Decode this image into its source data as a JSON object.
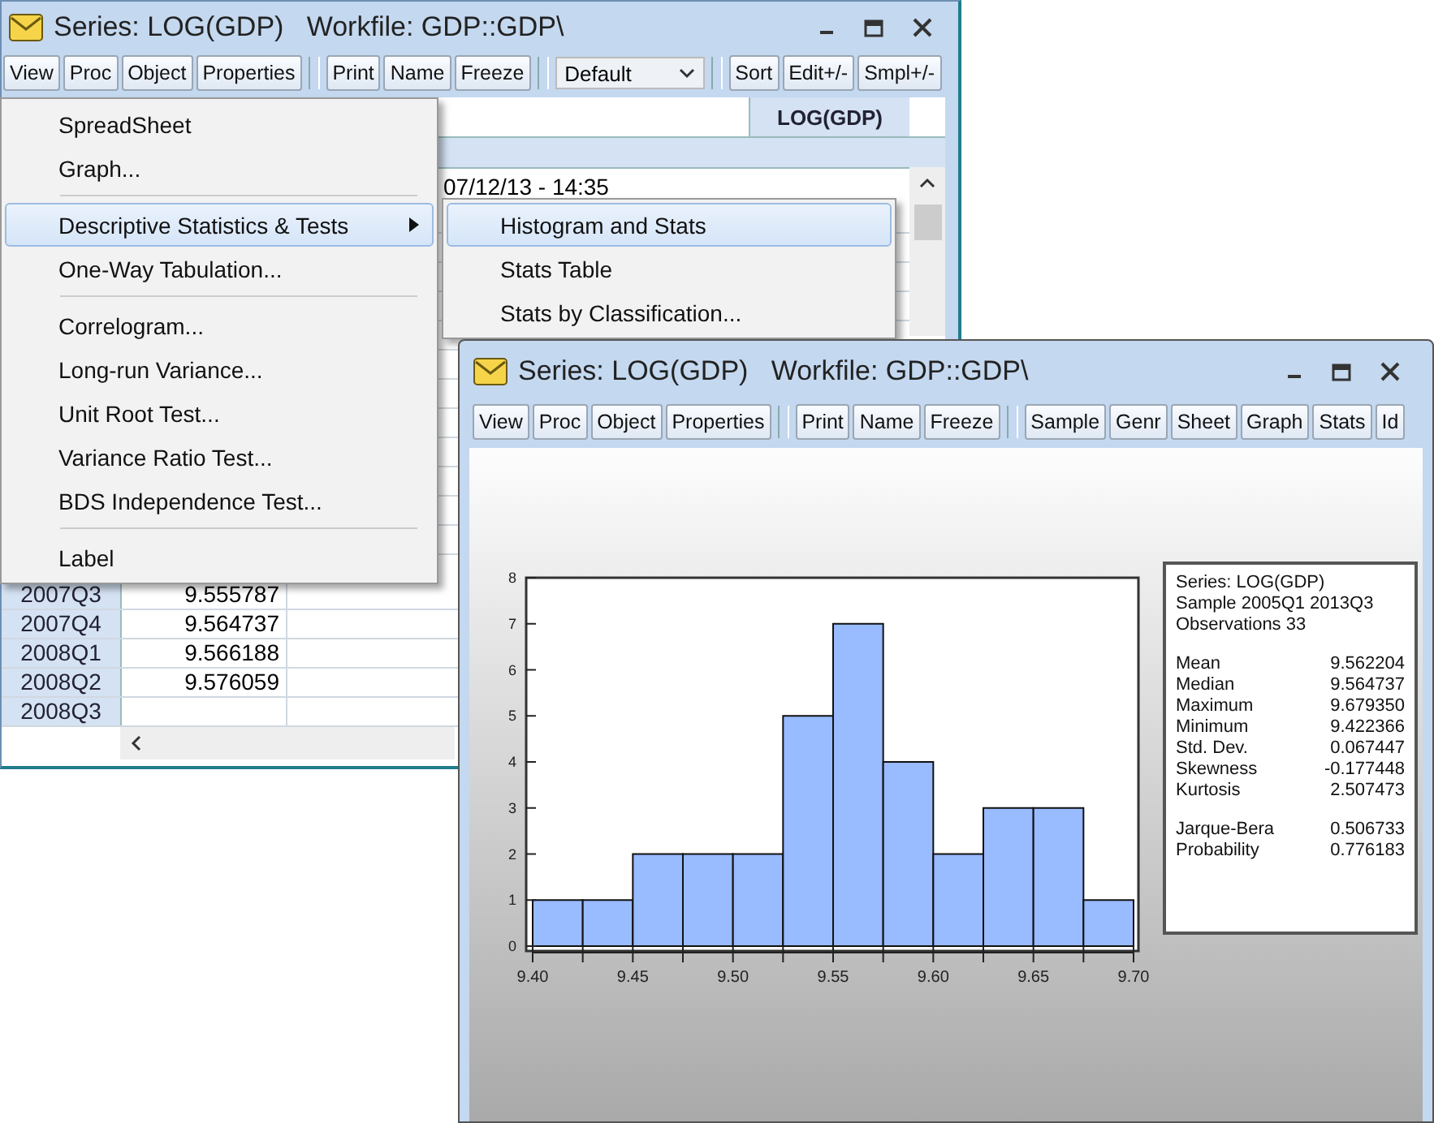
{
  "back_window": {
    "title": "Series: LOG(GDP)   Workfile: GDP::GDP\\",
    "toolbar": [
      {
        "kind": "button",
        "label": "View"
      },
      {
        "kind": "button",
        "label": "Proc"
      },
      {
        "kind": "button",
        "label": "Object"
      },
      {
        "kind": "button",
        "label": "Properties"
      },
      {
        "kind": "separator"
      },
      {
        "kind": "button",
        "label": "Print"
      },
      {
        "kind": "button",
        "label": "Name"
      },
      {
        "kind": "button",
        "label": "Freeze"
      },
      {
        "kind": "separator"
      },
      {
        "kind": "dropdown",
        "label": "Default"
      },
      {
        "kind": "separator"
      },
      {
        "kind": "button",
        "label": "Sort"
      },
      {
        "kind": "button",
        "label": "Edit+/-"
      },
      {
        "kind": "button",
        "label": "Smpl+/-"
      }
    ],
    "spreadsheet": {
      "column_header": "LOG(GDP)",
      "updated": "07/12/13 - 14:35",
      "rows": [
        {
          "obs": "2007Q3",
          "value": "9.555787"
        },
        {
          "obs": "2007Q4",
          "value": "9.564737"
        },
        {
          "obs": "2008Q1",
          "value": "9.566188"
        },
        {
          "obs": "2008Q2",
          "value": "9.576059"
        },
        {
          "obs": "2008Q3"
        }
      ]
    }
  },
  "menu": {
    "items": [
      {
        "kind": "item",
        "label": "SpreadSheet",
        "selected": false,
        "submenu": false
      },
      {
        "kind": "item",
        "label": "Graph...",
        "selected": false,
        "submenu": false
      },
      {
        "kind": "separator"
      },
      {
        "kind": "item",
        "label": "Descriptive Statistics & Tests",
        "selected": true,
        "submenu": true
      },
      {
        "kind": "item",
        "label": "One-Way Tabulation...",
        "selected": false,
        "submenu": false
      },
      {
        "kind": "separator"
      },
      {
        "kind": "item",
        "label": "Correlogram...",
        "selected": false,
        "submenu": false
      },
      {
        "kind": "item",
        "label": "Long-run Variance...",
        "selected": false,
        "submenu": false
      },
      {
        "kind": "item",
        "label": "Unit Root Test...",
        "selected": false,
        "submenu": false
      },
      {
        "kind": "item",
        "label": "Variance Ratio Test...",
        "selected": false,
        "submenu": false
      },
      {
        "kind": "item",
        "label": "BDS Independence Test...",
        "selected": false,
        "submenu": false
      },
      {
        "kind": "separator"
      },
      {
        "kind": "item",
        "label": "Label",
        "selected": false,
        "submenu": false
      }
    ]
  },
  "submenu": {
    "items": [
      {
        "label": "Histogram and Stats",
        "selected": true
      },
      {
        "label": "Stats Table",
        "selected": false
      },
      {
        "label": "Stats by Classification...",
        "selected": false
      }
    ]
  },
  "front_window": {
    "title": "Series: LOG(GDP)   Workfile: GDP::GDP\\",
    "toolbar": [
      {
        "kind": "button",
        "label": "View"
      },
      {
        "kind": "button",
        "label": "Proc"
      },
      {
        "kind": "button",
        "label": "Object"
      },
      {
        "kind": "button",
        "label": "Properties"
      },
      {
        "kind": "separator"
      },
      {
        "kind": "button",
        "label": "Print"
      },
      {
        "kind": "button",
        "label": "Name"
      },
      {
        "kind": "button",
        "label": "Freeze"
      },
      {
        "kind": "separator"
      },
      {
        "kind": "button",
        "label": "Sample"
      },
      {
        "kind": "button",
        "label": "Genr"
      },
      {
        "kind": "button",
        "label": "Sheet"
      },
      {
        "kind": "button",
        "label": "Graph"
      },
      {
        "kind": "button",
        "label": "Stats"
      },
      {
        "kind": "button",
        "label": "Id"
      }
    ],
    "histogram": {
      "chart_data": {
        "type": "bar",
        "x": [
          9.4125,
          9.4375,
          9.4625,
          9.4875,
          9.5125,
          9.5375,
          9.5625,
          9.5875,
          9.6125,
          9.6375,
          9.6625,
          9.6875
        ],
        "series": [
          {
            "color": "#99bbff",
            "values": [
              1,
              1,
              2,
              2,
              2,
              5,
              7,
              4,
              2,
              3,
              3,
              1
            ]
          }
        ],
        "xlim": [
          9.4,
          9.7
        ],
        "ylim": [
          0,
          8
        ],
        "xticks": [
          {
            "value": 9.4,
            "label": "9.40"
          },
          {
            "value": 9.45,
            "label": "9.45"
          },
          {
            "value": 9.5,
            "label": "9.50"
          },
          {
            "value": 9.55,
            "label": "9.55"
          },
          {
            "value": 9.6,
            "label": "9.60"
          },
          {
            "value": 9.65,
            "label": "9.65"
          },
          {
            "value": 9.7,
            "label": "9.70"
          }
        ],
        "yticks": [
          0,
          1,
          2,
          3,
          4,
          5,
          6,
          7,
          8
        ]
      }
    },
    "stats": {
      "header": [
        "Series: LOG(GDP)",
        "Sample 2005Q1 2013Q3",
        "Observations 33"
      ],
      "groups": [
        [
          {
            "label": "Mean",
            "value": "9.562204"
          },
          {
            "label": "Median",
            "value": "9.564737"
          },
          {
            "label": "Maximum",
            "value": "9.679350"
          },
          {
            "label": "Minimum",
            "value": "9.422366"
          },
          {
            "label": "Std. Dev.",
            "value": "0.067447"
          },
          {
            "label": "Skewness",
            "value": "-0.177448"
          },
          {
            "label": "Kurtosis",
            "value": "2.507473"
          }
        ],
        [
          {
            "label": "Jarque-Bera",
            "value": "0.506733"
          },
          {
            "label": "Probability",
            "value": "0.776183"
          }
        ]
      ]
    }
  }
}
